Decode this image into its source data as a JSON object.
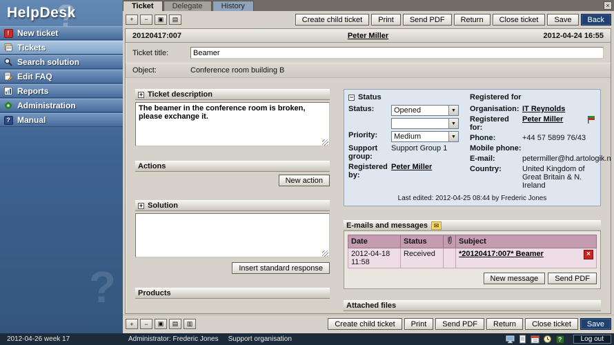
{
  "colors": {
    "sidebar_blue": "#3f6392",
    "dark_bar": "#1c2a3a",
    "mauve_header": "#c59cb0",
    "panel_blue": "#dee7f0",
    "alert_red": "#cc2222"
  },
  "icons": {
    "expand": "+",
    "collapse": "−",
    "window1": "▣",
    "window2": "▤",
    "window3": "▥",
    "envelope": "✉",
    "close_x": "×",
    "dropdown_arrow": "▼",
    "box_plus": "+",
    "box_minus": "−",
    "question": "?",
    "exclaim": "!"
  },
  "sidebar": {
    "logo": "HelpDesk",
    "watermark": "?",
    "items": [
      "New ticket",
      "Tickets",
      "Search solution",
      "Edit FAQ",
      "Reports",
      "Administration",
      "Manual"
    ],
    "footer": "2012-04-26  week 17"
  },
  "tabs": [
    "Ticket",
    "Delegate",
    "History"
  ],
  "toolbar": {
    "create_child": "Create child ticket",
    "print": "Print",
    "send_pdf": "Send PDF",
    "return": "Return",
    "close_ticket": "Close ticket",
    "save": "Save",
    "back": "Back"
  },
  "ticket": {
    "id": "20120417:007",
    "person": "Peter Miller",
    "datetime": "2012-04-24 16:55",
    "title_label": "Ticket title:",
    "title_value": "Beamer",
    "object_label": "Object:",
    "object_value": "Conference room building B"
  },
  "description": {
    "header": "Ticket description",
    "text": "The beamer in the conference room is broken, please exchange it."
  },
  "actions": {
    "header": "Actions",
    "new_action": "New action"
  },
  "solution": {
    "header": "Solution",
    "text": "",
    "insert_standard": "Insert standard response"
  },
  "products": {
    "header": "Products"
  },
  "status": {
    "header": "Status",
    "registered_for_header": "Registered for",
    "status_label": "Status:",
    "status_value": "Opened",
    "sub_status_value": "",
    "priority_label": "Priority:",
    "priority_value": "Medium",
    "support_group_label": "Support group:",
    "support_group_value": "Support Group 1",
    "registered_by_label": "Registered by:",
    "registered_by_value": "Peter Miller",
    "organisation_label": "Organisation:",
    "organisation_value": "IT Reynolds",
    "registered_for_label": "Registered for:",
    "registered_for_value": "Peter Miller",
    "phone_label": "Phone:",
    "phone_value": "+44 57 5899 76/43",
    "mobile_label": "Mobile phone:",
    "mobile_value": "",
    "email_label": "E-mail:",
    "email_value": "petermiller@hd.artologik.net",
    "country_label": "Country:",
    "country_value": "United Kingdom of Great Britain & N. Ireland",
    "last_edited": "Last edited: 2012-04-25 08:44 by Frederic Jones"
  },
  "emails": {
    "header": "E-mails and messages",
    "col_date": "Date",
    "col_status": "Status",
    "col_subject": "Subject",
    "rows": [
      {
        "date": "2012-04-18 11:58",
        "status": "Received",
        "subject": "*20120417:007* Beamer"
      }
    ],
    "new_message": "New message",
    "send_pdf": "Send PDF"
  },
  "attached": {
    "header": "Attached files"
  },
  "statusbar": {
    "user": "Administrator: Frederic Jones",
    "org": "Support organisation",
    "logout": "Log out"
  }
}
